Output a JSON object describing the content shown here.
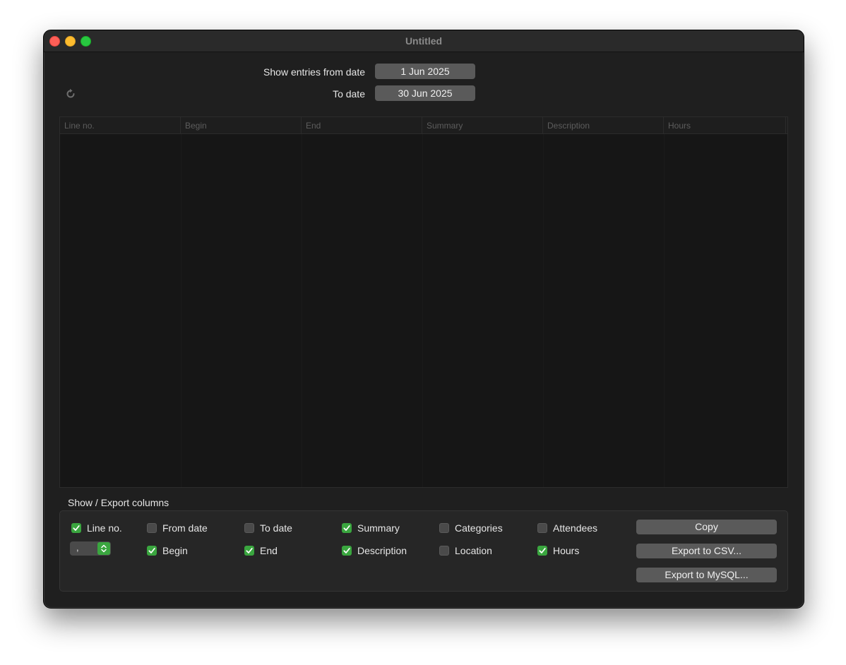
{
  "window": {
    "title": "Untitled"
  },
  "filters": {
    "from_label": "Show entries from date",
    "from_value": "1 Jun 2025",
    "to_label": "To date",
    "to_value": "30 Jun 2025"
  },
  "table": {
    "columns": [
      "Line no.",
      "Begin",
      "End",
      "Summary",
      "Description",
      "Hours"
    ],
    "rows": []
  },
  "columns_section": {
    "title": "Show / Export columns",
    "separator_value": ",",
    "checkboxes": [
      {
        "label": "Line no.",
        "checked": true
      },
      {
        "label": "From date",
        "checked": false
      },
      {
        "label": "To date",
        "checked": false
      },
      {
        "label": "Summary",
        "checked": true
      },
      {
        "label": "Categories",
        "checked": false
      },
      {
        "label": "Attendees",
        "checked": false
      },
      {
        "label": "Begin",
        "checked": true
      },
      {
        "label": "End",
        "checked": true
      },
      {
        "label": "Description",
        "checked": true
      },
      {
        "label": "Location",
        "checked": false
      },
      {
        "label": "Hours",
        "checked": true
      }
    ]
  },
  "buttons": {
    "copy": "Copy",
    "export_csv": "Export to CSV...",
    "export_mysql": "Export to MySQL..."
  },
  "colors": {
    "accent": "#3aa63f",
    "window_bg": "#1f1f1f",
    "table_bg": "#161616"
  }
}
